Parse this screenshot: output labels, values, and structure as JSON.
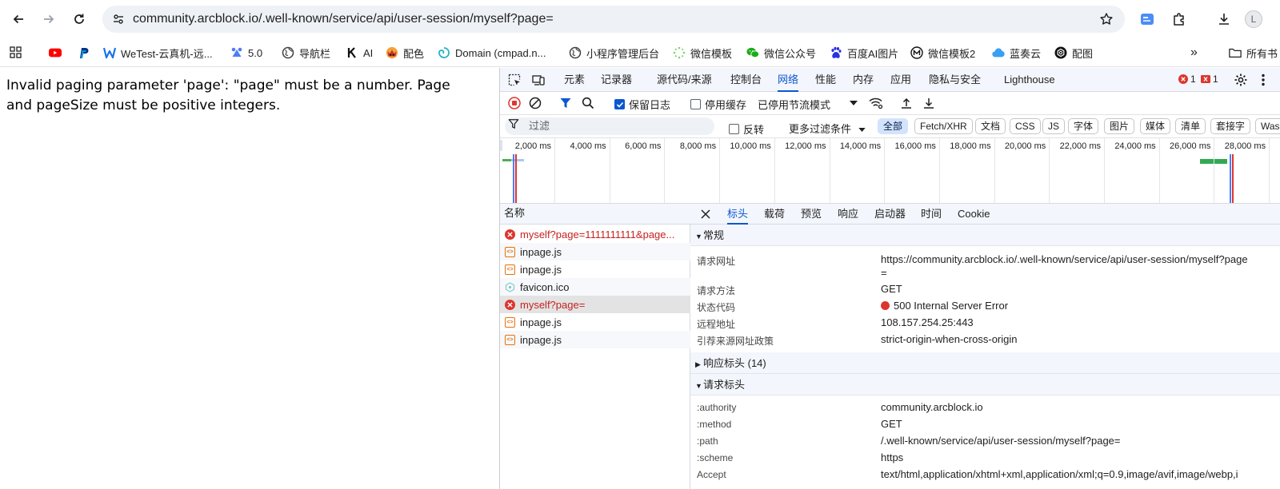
{
  "browser": {
    "url": "community.arcblock.io/.well-known/service/api/user-session/myself?page=",
    "avatar_letter": "L",
    "accent": "#0b57d0"
  },
  "bookmarks": [
    {
      "label": "",
      "icon": "apps-grid-icon"
    },
    {
      "label": "",
      "icon": "youtube-icon"
    },
    {
      "label": "",
      "icon": "paypal-icon"
    },
    {
      "label": "WeTest-云真机-远...",
      "icon": "wetest-icon"
    },
    {
      "label": "5.0",
      "icon": "bear-icon"
    },
    {
      "label": "导航栏",
      "icon": "globe-icon"
    },
    {
      "label": "AI",
      "icon": "k-icon"
    },
    {
      "label": "配色",
      "icon": "palette-icon"
    },
    {
      "label": "Domain (cmpad.n...",
      "icon": "domain-icon"
    },
    {
      "label": "小程序管理后台",
      "icon": "globe-icon"
    },
    {
      "label": "微信模板",
      "icon": "spark-icon"
    },
    {
      "label": "微信公众号",
      "icon": "wechat-icon"
    },
    {
      "label": "百度AI图片",
      "icon": "baidu-icon"
    },
    {
      "label": "微信模板2",
      "icon": "m-icon"
    },
    {
      "label": "蓝奏云",
      "icon": "cloud-icon"
    },
    {
      "label": "配图",
      "icon": "openai-icon"
    }
  ],
  "bookmarks_overflow": "»",
  "bookmarks_folder": "所有书",
  "page": {
    "message": "Invalid paging parameter 'page': \"page\" must be a number. Page and pageSize must be positive integers."
  },
  "devtools": {
    "tabs": [
      "元素",
      "记录器",
      "源代码/来源",
      "控制台",
      "网络",
      "性能",
      "内存",
      "应用",
      "隐私与安全",
      "Lighthouse"
    ],
    "active_tab": "网络",
    "error_count": "1",
    "issue_count": "1",
    "toolbar": {
      "preserve_log": "保留日志",
      "disable_cache": "停用缓存",
      "throttle": "已停用节流模式"
    },
    "filter": {
      "placeholder": "过滤",
      "invert": "反转",
      "more_filters": "更多过滤条件",
      "types": [
        "全部",
        "Fetch/XHR",
        "文档",
        "CSS",
        "JS",
        "字体",
        "图片",
        "媒体",
        "清单",
        "套接字",
        "Wasm"
      ]
    },
    "timeline_ticks": [
      "2,000 ms",
      "4,000 ms",
      "6,000 ms",
      "8,000 ms",
      "10,000 ms",
      "12,000 ms",
      "14,000 ms",
      "16,000 ms",
      "18,000 ms",
      "20,000 ms",
      "22,000 ms",
      "24,000 ms",
      "26,000 ms",
      "28,000 ms"
    ],
    "request_list_header": "名称",
    "requests": [
      {
        "name": "myself?page=1111111111&page...",
        "type": "error"
      },
      {
        "name": "inpage.js",
        "type": "script"
      },
      {
        "name": "inpage.js",
        "type": "script"
      },
      {
        "name": "favicon.ico",
        "type": "icon"
      },
      {
        "name": "myself?page=",
        "type": "error"
      },
      {
        "name": "inpage.js",
        "type": "script"
      },
      {
        "name": "inpage.js",
        "type": "script"
      }
    ],
    "detail_tabs": [
      "标头",
      "载荷",
      "预览",
      "响应",
      "启动器",
      "时间",
      "Cookie"
    ],
    "general": {
      "title": "常规",
      "request_url_key": "请求网址",
      "request_url": "https://community.arcblock.io/.well-known/service/api/user-session/myself?page",
      "request_url_cont": "=",
      "method_key": "请求方法",
      "method": "GET",
      "status_key": "状态代码",
      "status": "500 Internal Server Error",
      "remote_key": "远程地址",
      "remote": "108.157.254.25:443",
      "referrer_key": "引荐来源网址政策",
      "referrer": "strict-origin-when-cross-origin"
    },
    "response_headers_title": "响应标头 (14)",
    "request_headers": {
      "title": "请求标头",
      "authority_key": ":authority",
      "authority": "community.arcblock.io",
      "method_key": ":method",
      "method": "GET",
      "path_key": ":path",
      "path": "/.well-known/service/api/user-session/myself?page=",
      "scheme_key": ":scheme",
      "scheme": "https",
      "accept_key": "Accept",
      "accept": "text/html,application/xhtml+xml,application/xml;q=0.9,image/avif,image/webp,i"
    }
  }
}
